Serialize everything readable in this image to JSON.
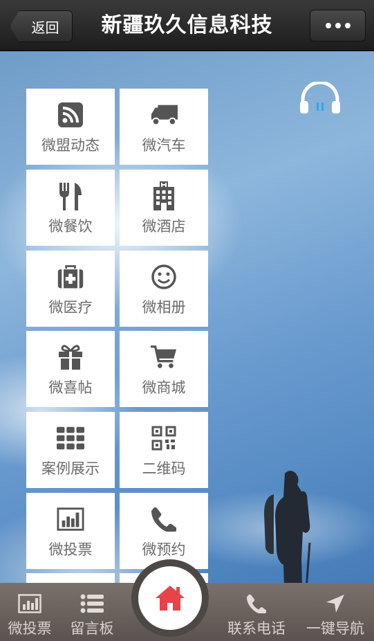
{
  "header": {
    "back_label": "返回",
    "title": "新疆玖久信息科技"
  },
  "music": {
    "icon": "headphones-icon",
    "accent": "#2fa7e6"
  },
  "tiles": [
    {
      "label": "微盟动态",
      "icon": "rss-icon"
    },
    {
      "label": "微汽车",
      "icon": "truck-icon"
    },
    {
      "label": "微餐饮",
      "icon": "fork-knife-icon"
    },
    {
      "label": "微酒店",
      "icon": "hotel-building-icon"
    },
    {
      "label": "微医疗",
      "icon": "medical-kit-icon"
    },
    {
      "label": "微相册",
      "icon": "smiley-icon"
    },
    {
      "label": "微喜帖",
      "icon": "gift-icon"
    },
    {
      "label": "微商城",
      "icon": "shopping-cart-icon"
    },
    {
      "label": "案例展示",
      "icon": "grid-icon"
    },
    {
      "label": "二维码",
      "icon": "qr-code-icon"
    },
    {
      "label": "微投票",
      "icon": "bar-chart-icon"
    },
    {
      "label": "微预约",
      "icon": "phone-icon"
    }
  ],
  "bottom_nav": {
    "items": [
      {
        "label": "微投票",
        "icon": "bar-chart-icon"
      },
      {
        "label": "留言板",
        "icon": "list-icon"
      },
      {
        "label": "联系电话",
        "icon": "phone-icon"
      },
      {
        "label": "一键导航",
        "icon": "navigation-arrow-icon"
      }
    ],
    "home": {
      "icon": "home-icon",
      "color": "#e8424a"
    }
  },
  "colors": {
    "icon_gray": "#555555",
    "label_gray": "#6b6b6b"
  }
}
